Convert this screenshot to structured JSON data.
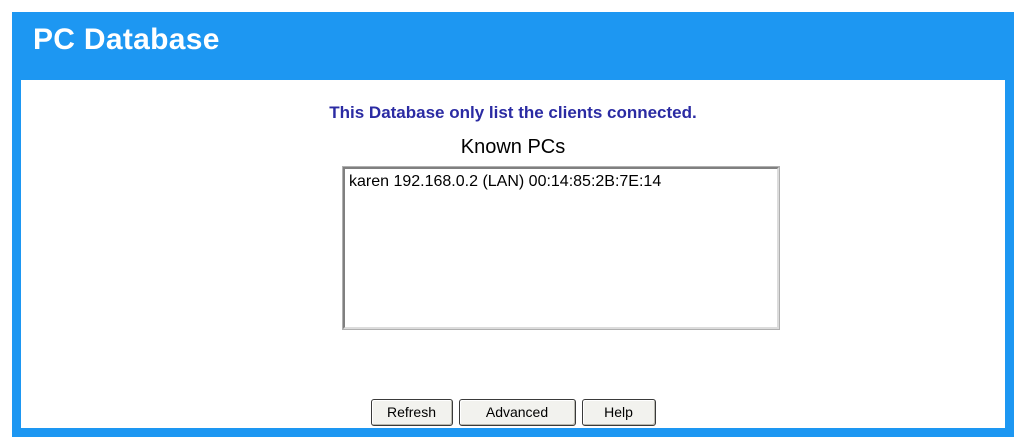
{
  "header": {
    "title": "PC Database"
  },
  "main": {
    "notice": "This Database only list the clients connected.",
    "known_pcs": {
      "label": "Known PCs",
      "items": [
        "karen 192.168.0.2 (LAN) 00:14:85:2B:7E:14"
      ]
    },
    "buttons": {
      "refresh": "Refresh",
      "advanced": "Advanced",
      "help": "Help"
    }
  },
  "colors": {
    "frame": "#1d97f2",
    "notice_text": "#2b2ba3",
    "panel": "#ffffff"
  }
}
